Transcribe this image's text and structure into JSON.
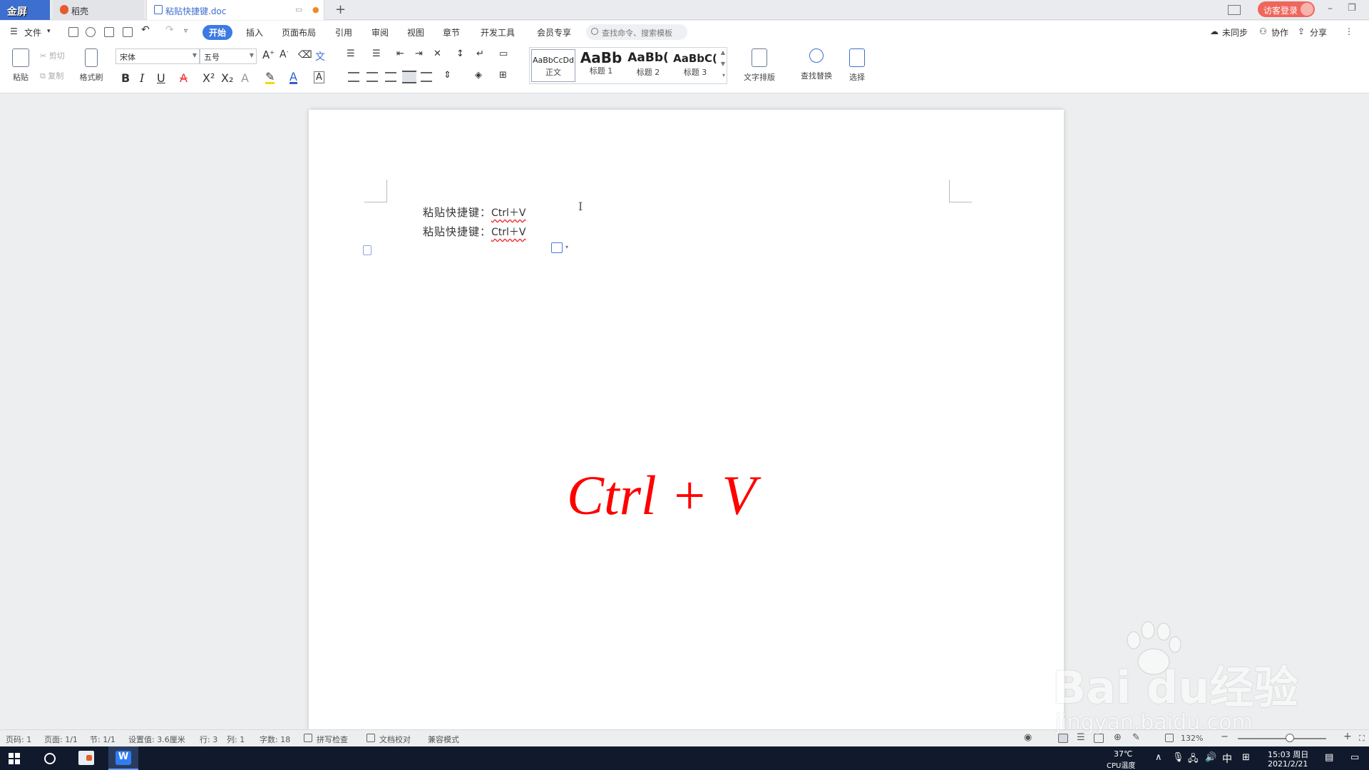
{
  "tabbar": {
    "home_label": "金屏",
    "tabs": [
      {
        "label": "稻壳"
      },
      {
        "label": "粘贴快捷键.doc"
      }
    ],
    "new_tab": "+",
    "login_label": "访客登录"
  },
  "menubar": {
    "file_label": "文件",
    "items": [
      "开始",
      "插入",
      "页面布局",
      "引用",
      "审阅",
      "视图",
      "章节",
      "开发工具",
      "会员专享"
    ],
    "search_placeholder": "查找命令、搜索模板",
    "right": {
      "sync": "未同步",
      "collab": "协作",
      "share": "分享"
    }
  },
  "ribbon": {
    "paste": "粘贴",
    "cut": "剪切",
    "copy": "复制",
    "format_painter": "格式刷",
    "font_name": "宋体",
    "font_size": "五号",
    "format_buttons": [
      "B",
      "I",
      "U",
      "A",
      "X²",
      "X₂",
      "A"
    ],
    "styles": [
      {
        "preview": "AaBbCcDd",
        "name": "正文"
      },
      {
        "preview": "AaBb",
        "name": "标题 1"
      },
      {
        "preview": "AaBb(",
        "name": "标题 2"
      },
      {
        "preview": "AaBbC(",
        "name": "标题 3"
      }
    ],
    "text_layout": "文字排版",
    "find_replace": "查找替换",
    "select": "选择"
  },
  "document": {
    "lines": [
      {
        "label": "粘贴快捷键：",
        "keys": "Ctrl＋V"
      },
      {
        "label": "粘贴快捷键：",
        "keys": "Ctrl＋V"
      }
    ],
    "overlay_text": "Ctrl + V",
    "overlay_color": "#ff0000"
  },
  "statusbar": {
    "page_num": "页码: 1",
    "pages": "页面: 1/1",
    "section": "节: 1/1",
    "setting": "设置值: 3.6厘米",
    "row": "行: 3",
    "col": "列: 1",
    "word_count": "字数: 18",
    "spell_check": "拼写检查",
    "doc_proof": "文档校对",
    "compat_mode": "兼容模式",
    "zoom": "132%"
  },
  "taskbar": {
    "weather_temp": "37℃",
    "weather_label": "CPU温度",
    "ime": "中",
    "time": "15:03 周日",
    "date": "2021/2/21"
  },
  "watermark": {
    "brand": "Bai du经验",
    "url": "jingyan.baidu.com"
  }
}
